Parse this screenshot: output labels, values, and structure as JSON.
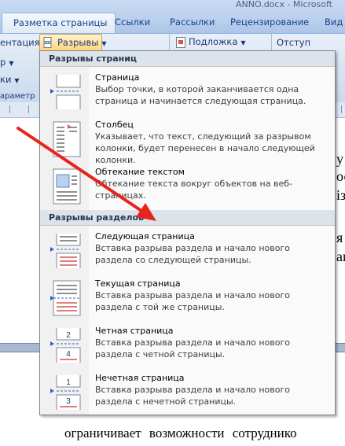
{
  "window": {
    "title": "ANNO.docx - Microsoft"
  },
  "tabs": [
    "Разметка страницы",
    "Ссылки",
    "Рассылки",
    "Рецензирование",
    "Вид"
  ],
  "ribbon": {
    "orientation_fragment": "ентация",
    "breaks_label": "Разрывы",
    "watermark_label": "Подложка",
    "indent_label": "Отступ",
    "left_fragments": [
      "р",
      "ки",
      "араметр"
    ]
  },
  "menu": {
    "page_breaks_header": "Разрывы страниц",
    "section_breaks_header": "Разрывы разделов",
    "page_break_items": [
      {
        "title": "Страница",
        "desc": "Выбор точки, в которой заканчивается одна страница и начинается следующая страница."
      },
      {
        "title": "Столбец",
        "desc": "Указывает, что текст, следующий за разрывом колонки, будет перенесен в начало следующей колонки."
      },
      {
        "title": "Обтекание текстом",
        "desc": "Обтекание текста вокруг объектов на веб-страницах."
      }
    ],
    "section_break_items": [
      {
        "title": "Следующая страница",
        "desc": "Вставка разрыва раздела и начало нового раздела со следующей страницы."
      },
      {
        "title": "Текущая страница",
        "desc": "Вставка разрыва раздела и начало нового раздела с той же страницы."
      },
      {
        "title": "Четная страница",
        "desc": "Вставка разрыва раздела и начало нового раздела с четной страницы."
      },
      {
        "title": "Нечетная страница",
        "desc": "Вставка разрыва раздела и начало нового раздела с нечетной страницы."
      }
    ]
  },
  "document": {
    "fragments": [
      "у",
      "ос",
      "із",
      "я",
      "ак"
    ],
    "body_line": "ограничивает возможности сотруднико"
  },
  "colors": {
    "arrow": "#e8231e",
    "ribbon": "#d7e4f2",
    "menu_header": "#dde3ea"
  }
}
